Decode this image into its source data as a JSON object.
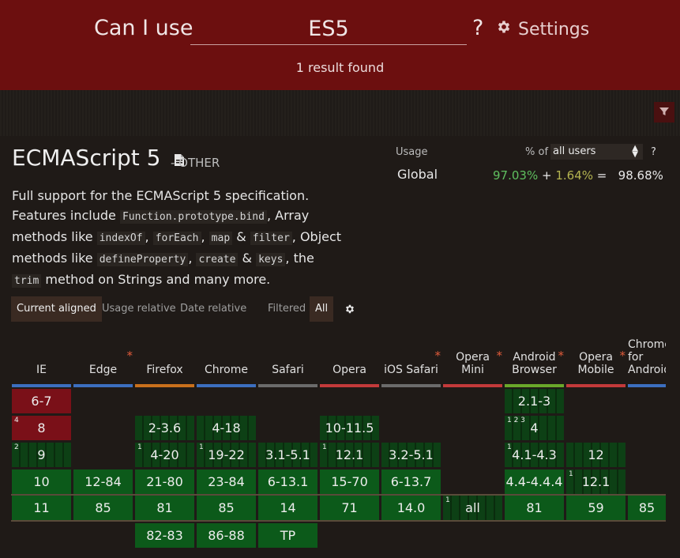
{
  "header": {
    "prefix": "Can I use",
    "search_value": "ES5",
    "question": "?",
    "settings_label": "Settings",
    "result_count": "1 result found"
  },
  "feature": {
    "title": "ECMAScript 5",
    "category": "- OTHER",
    "desc": [
      {
        "t": "Full support for the ECMAScript 5 specification."
      },
      {
        "t": "Features include "
      },
      {
        "c": "Function.prototype.bind"
      },
      {
        "t": ", Array methods like "
      },
      {
        "c": "indexOf"
      },
      {
        "t": ", "
      },
      {
        "c": "forEach"
      },
      {
        "t": ", "
      },
      {
        "c": "map"
      },
      {
        "t": " & "
      },
      {
        "c": "filter"
      },
      {
        "t": ", Object methods like "
      },
      {
        "c": "defineProperty"
      },
      {
        "t": ", "
      },
      {
        "c": "create"
      },
      {
        "t": " & "
      },
      {
        "c": "keys"
      },
      {
        "t": ", the "
      },
      {
        "c": "trim"
      },
      {
        "t": " method on Strings and many more."
      }
    ]
  },
  "usage": {
    "label": "Usage",
    "pct_of": "% of",
    "users_select": "all users",
    "help": "?",
    "global_label": "Global",
    "full": "97.03%",
    "plus": "+",
    "partial": "1.64%",
    "equals": "=",
    "total": "98.68%"
  },
  "tabs": {
    "current": "Current aligned",
    "usage_relative": "Usage relative",
    "date_relative": "Date relative",
    "filtered": "Filtered",
    "all": "All"
  },
  "colors": {
    "header_bg": "#6c0f0f",
    "supported": "#0c5a1a",
    "unsupported": "#7a1018",
    "accent_star": "#e05a3a"
  },
  "browsers": [
    {
      "name": "IE",
      "star": false,
      "bar": "#3c6fbf",
      "cells": [
        {
          "v": "6-7",
          "s": "n"
        },
        {
          "v": "8",
          "s": "n",
          "note": "4"
        },
        {
          "v": "9",
          "s": "p",
          "note": "2"
        },
        {
          "v": "10",
          "s": "y"
        },
        {
          "v": "11",
          "s": "y"
        }
      ]
    },
    {
      "name": "Edge",
      "star": true,
      "bar": "#3c6fbf",
      "cells": [
        {
          "v": "",
          "s": ""
        },
        {
          "v": "",
          "s": ""
        },
        {
          "v": "",
          "s": ""
        },
        {
          "v": "12-84",
          "s": "y"
        },
        {
          "v": "85",
          "s": "y"
        }
      ]
    },
    {
      "name": "Firefox",
      "star": false,
      "bar": "#c8701c",
      "cells": [
        {
          "v": "",
          "s": ""
        },
        {
          "v": "2-3.6",
          "s": "p"
        },
        {
          "v": "4-20",
          "s": "p",
          "note": "1"
        },
        {
          "v": "21-80",
          "s": "y"
        },
        {
          "v": "81",
          "s": "y"
        },
        {
          "v": "82-83",
          "s": "y"
        }
      ]
    },
    {
      "name": "Chrome",
      "star": false,
      "bar": "#3c6fbf",
      "cells": [
        {
          "v": "",
          "s": ""
        },
        {
          "v": "4-18",
          "s": "p"
        },
        {
          "v": "19-22",
          "s": "p",
          "note": "1"
        },
        {
          "v": "23-84",
          "s": "y"
        },
        {
          "v": "85",
          "s": "y"
        },
        {
          "v": "86-88",
          "s": "y"
        }
      ]
    },
    {
      "name": "Safari",
      "star": false,
      "bar": "#6b6b6b",
      "cells": [
        {
          "v": "",
          "s": ""
        },
        {
          "v": "",
          "s": ""
        },
        {
          "v": "3.1-5.1",
          "s": "p"
        },
        {
          "v": "6-13.1",
          "s": "y"
        },
        {
          "v": "14",
          "s": "y"
        },
        {
          "v": "TP",
          "s": "y"
        }
      ]
    },
    {
      "name": "Opera",
      "star": false,
      "bar": "#c23a3a",
      "cells": [
        {
          "v": "",
          "s": ""
        },
        {
          "v": "10-11.5",
          "s": "p"
        },
        {
          "v": "12.1",
          "s": "p",
          "note": "1"
        },
        {
          "v": "15-70",
          "s": "y"
        },
        {
          "v": "71",
          "s": "y"
        }
      ]
    },
    {
      "name": "iOS Safari",
      "star": true,
      "bar": "#6b6b6b",
      "cells": [
        {
          "v": "",
          "s": ""
        },
        {
          "v": "",
          "s": ""
        },
        {
          "v": "3.2-5.1",
          "s": "p"
        },
        {
          "v": "6-13.7",
          "s": "y"
        },
        {
          "v": "14.0",
          "s": "y"
        }
      ]
    },
    {
      "name": "Opera Mini",
      "star": true,
      "bar": "#c23a3a",
      "cells": [
        {
          "v": "",
          "s": ""
        },
        {
          "v": "",
          "s": ""
        },
        {
          "v": "",
          "s": ""
        },
        {
          "v": "",
          "s": ""
        },
        {
          "v": "all",
          "s": "p",
          "note": "1"
        }
      ]
    },
    {
      "name": "Android Browser",
      "star": true,
      "bar": "#6aa82a",
      "cells": [
        {
          "v": "2.1-3",
          "s": "p"
        },
        {
          "v": "4",
          "s": "p",
          "note": "1 2 3"
        },
        {
          "v": "4.1-4.3",
          "s": "p",
          "note": "1"
        },
        {
          "v": "4.4-4.4.4",
          "s": "y"
        },
        {
          "v": "81",
          "s": "y"
        }
      ]
    },
    {
      "name": "Opera Mobile",
      "star": true,
      "bar": "#c23a3a",
      "cells": [
        {
          "v": "",
          "s": ""
        },
        {
          "v": "",
          "s": ""
        },
        {
          "v": "12",
          "s": "p"
        },
        {
          "v": "12.1",
          "s": "p",
          "note": "1"
        },
        {
          "v": "59",
          "s": "y"
        }
      ]
    },
    {
      "name": "Chrome for Android",
      "star": false,
      "bar": "#3c6fbf",
      "cells": [
        {
          "v": "",
          "s": ""
        },
        {
          "v": "",
          "s": ""
        },
        {
          "v": "",
          "s": ""
        },
        {
          "v": "",
          "s": ""
        },
        {
          "v": "85",
          "s": "y"
        }
      ]
    }
  ]
}
